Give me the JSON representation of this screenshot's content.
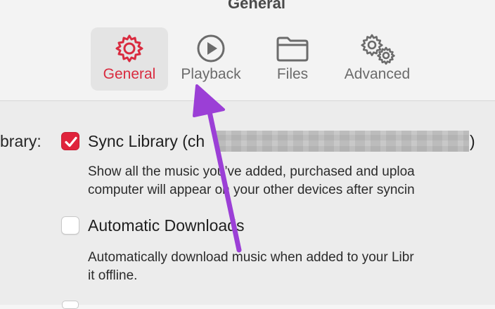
{
  "window": {
    "title": "General"
  },
  "tabs": [
    {
      "label": "General",
      "icon": "gear-icon",
      "selected": true
    },
    {
      "label": "Playback",
      "icon": "play-circle-icon",
      "selected": false
    },
    {
      "label": "Files",
      "icon": "folder-icon",
      "selected": false
    },
    {
      "label": "Advanced",
      "icon": "gears-icon",
      "selected": false
    }
  ],
  "settings": {
    "library_label": "brary:",
    "sync": {
      "label_start": "Sync Library (ch",
      "label_end": ")",
      "checked": true,
      "desc_line1": "Show all the music you’ve added, purchased and uploa",
      "desc_line2": "computer will appear on your other devices after syncin"
    },
    "auto_downloads": {
      "label": "Automatic Downloads",
      "checked": false,
      "desc_line1": "Automatically download music when added to your Libr",
      "desc_line2": "it offline."
    }
  },
  "colors": {
    "accent": "#d92b3f",
    "checkbox_on": "#e0233c",
    "annotation_arrow": "#9b3fd6"
  }
}
